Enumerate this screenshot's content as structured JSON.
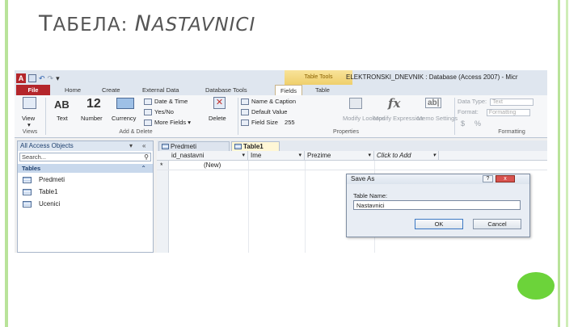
{
  "slide": {
    "title_first": "T",
    "title_rest": "АБЕЛА",
    "title_colon": ": ",
    "title_second_first": "N",
    "title_second_rest": "ASTAVNICI",
    "accent_green": "#6cd33a"
  },
  "window": {
    "title": "ELEKTRONSKI_DNEVNIK : Database (Access 2007) - Micr",
    "context_tab": "Table Tools",
    "app_icon": "A"
  },
  "ribbon_tabs": {
    "file": "File",
    "home": "Home",
    "create": "Create",
    "external": "External Data",
    "dbtools": "Database Tools",
    "fields": "Fields",
    "table": "Table"
  },
  "ribbon": {
    "view": "View",
    "text": "Text",
    "number": "Number",
    "currency": "Currency",
    "text_glyph": "AB",
    "number_glyph": "12",
    "date_time": "Date & Time",
    "yes_no": "Yes/No",
    "more_fields": "More Fields",
    "delete": "Delete",
    "group_views": "Views",
    "group_add_delete": "Add & Delete",
    "name_caption": "Name & Caption",
    "default_value": "Default Value",
    "field_size_label": "Field Size",
    "field_size_value": "255",
    "modify_lookups": "Modify Lookups",
    "modify_expression": "Modify Expression",
    "memo_settings": "Memo Settings",
    "group_properties": "Properties",
    "data_type_label": "Data Type:",
    "data_type_value": "Text",
    "format_label": "Format:",
    "format_value": "Formatting",
    "currency_symbol": "$",
    "percent_symbol": "%",
    "group_formatting": "Formatting",
    "fx_glyph": "fx",
    "ab_glyph": "ab|"
  },
  "nav_pane": {
    "header": "All Access Objects",
    "search_placeholder": "Search...",
    "group": "Tables",
    "items": [
      {
        "label": "Predmeti"
      },
      {
        "label": "Table1"
      },
      {
        "label": "Ucenici"
      }
    ]
  },
  "tabs": {
    "doc1": "Predmeti",
    "doc2": "Table1"
  },
  "grid": {
    "columns": [
      {
        "label": "id_nastavni"
      },
      {
        "label": "Ime"
      },
      {
        "label": "Prezime"
      },
      {
        "label": "Click to Add"
      }
    ],
    "new_row_marker": "*",
    "new_row_value": "(New)"
  },
  "dialog": {
    "title": "Save As",
    "label": "Table Name:",
    "value": "Nastavnici",
    "ok": "OK",
    "cancel": "Cancel",
    "help": "?",
    "close": "x"
  }
}
